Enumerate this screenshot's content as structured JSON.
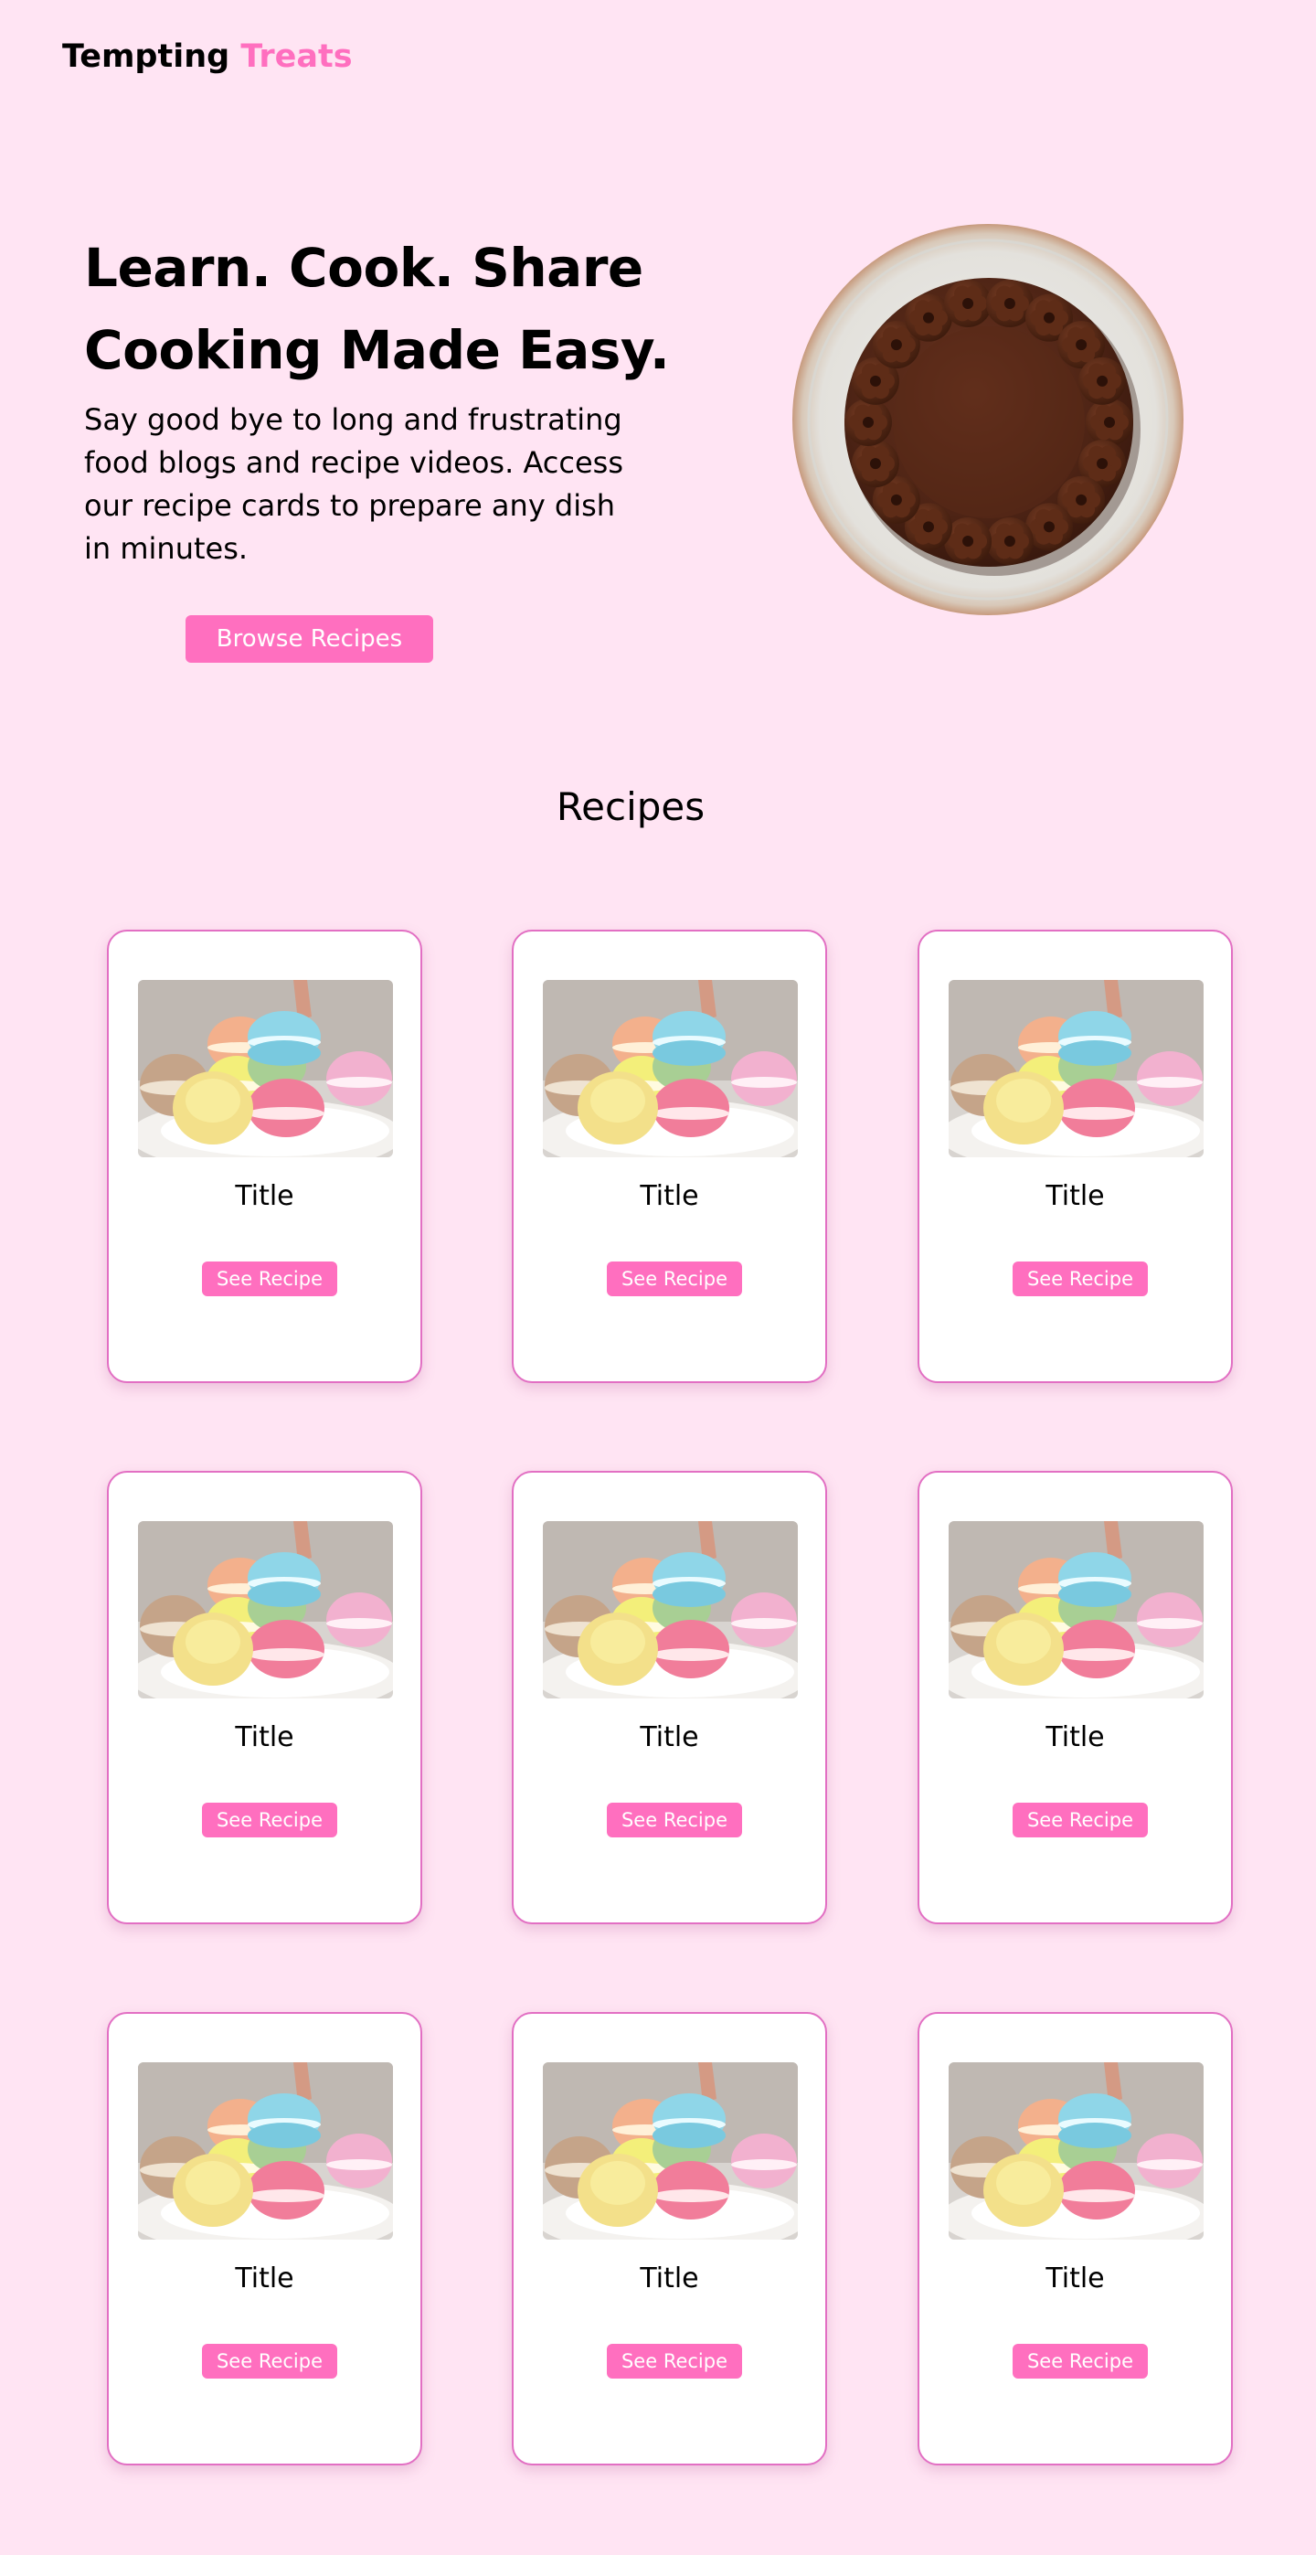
{
  "header": {
    "logo_part1": "Tempting",
    "logo_part2": "Treats"
  },
  "hero": {
    "title_line1": "Learn. Cook. Share",
    "title_line2": "Cooking Made Easy.",
    "description": "Say good bye to long and frustrating food blogs and recipe videos. Access our recipe cards to prepare any dish in minutes.",
    "button_label": "Browse Recipes"
  },
  "recipes": {
    "heading": "Recipes",
    "cards": [
      {
        "title": "Title",
        "button_label": "See Recipe"
      },
      {
        "title": "Title",
        "button_label": "See Recipe"
      },
      {
        "title": "Title",
        "button_label": "See Recipe"
      },
      {
        "title": "Title",
        "button_label": "See Recipe"
      },
      {
        "title": "Title",
        "button_label": "See Recipe"
      },
      {
        "title": "Title",
        "button_label": "See Recipe"
      },
      {
        "title": "Title",
        "button_label": "See Recipe"
      },
      {
        "title": "Title",
        "button_label": "See Recipe"
      },
      {
        "title": "Title",
        "button_label": "See Recipe"
      }
    ]
  },
  "colors": {
    "background": "#ffe4f3",
    "accent": "#ff6fbf",
    "card_border": "#e26fc3"
  },
  "images": {
    "hero": "chocolate-cake-image",
    "card": "macarons-image"
  }
}
